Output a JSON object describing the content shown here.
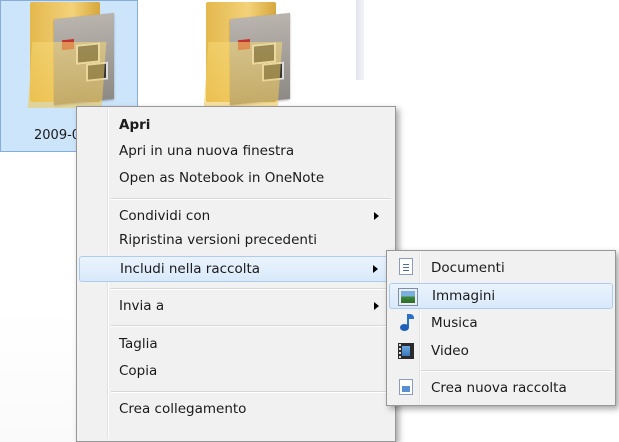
{
  "explorer": {
    "folder_label": "2009-0"
  },
  "context_menu": {
    "items": [
      {
        "label": "Apri"
      },
      {
        "label": "Apri in una nuova finestra"
      },
      {
        "label": "Open as Notebook in OneNote"
      },
      {
        "label": "Condividi con"
      },
      {
        "label": "Ripristina versioni precedenti"
      },
      {
        "label": "Includi nella raccolta"
      },
      {
        "label": "Invia a"
      },
      {
        "label": "Taglia"
      },
      {
        "label": "Copia"
      },
      {
        "label": "Crea collegamento"
      }
    ]
  },
  "submenu": {
    "items": [
      {
        "label": "Documenti",
        "icon": "documents-library-icon"
      },
      {
        "label": "Immagini",
        "icon": "pictures-library-icon"
      },
      {
        "label": "Musica",
        "icon": "music-library-icon"
      },
      {
        "label": "Video",
        "icon": "video-library-icon"
      },
      {
        "label": "Crea nuova raccolta",
        "icon": "new-library-icon"
      }
    ]
  },
  "colors": {
    "menu_background": "#f1f1f1",
    "highlight_border": "#aecbf0",
    "highlight_fill": "#d9e9fa",
    "selection_fill": "#cde5fb"
  }
}
